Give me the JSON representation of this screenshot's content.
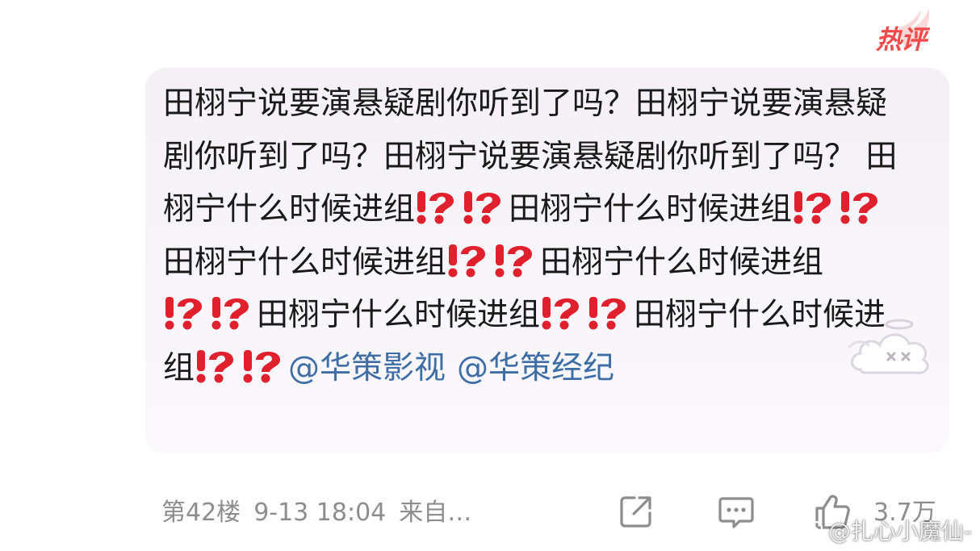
{
  "badge": {
    "text": "热评",
    "color": "#f24a4a"
  },
  "comment": {
    "segments": [
      "田栩宁说要演悬疑剧你听到了吗？田栩宁说要演悬疑剧你听到了吗？田栩宁说要演悬疑剧你听到了吗？ 田栩宁什么时候进组",
      "田栩宁什么时候进组",
      "田栩宁什么时候进组",
      "田栩宁什么时候进组",
      "田栩宁什么时候进组",
      "田栩宁什么时候进组"
    ],
    "emoji_name": "interrobang-emoji",
    "emoji_color": "#e0212d",
    "mentions": [
      "@华策影视",
      "@华策经纪"
    ],
    "mention_color": "#3e6ea5",
    "bubble_color": "#f5f2f7"
  },
  "footer": {
    "floor": "第42楼",
    "date": "9-13 18:04",
    "source": "来自…",
    "like_count": "3.7万",
    "icons": [
      "share-icon",
      "comment-icon",
      "like-icon"
    ]
  },
  "watermark": {
    "text": "@扎心小魔仙-"
  }
}
